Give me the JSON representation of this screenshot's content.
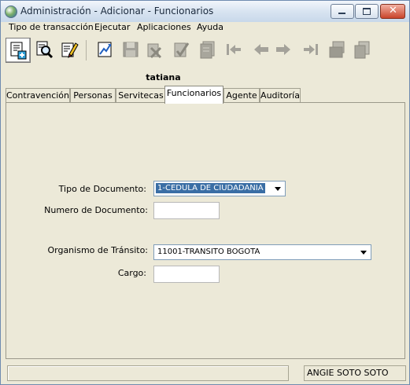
{
  "window": {
    "title": "Administración - Adicionar - Funcionarios"
  },
  "menu": [
    "Tipo de transacción",
    "Ejecutar",
    "Aplicaciones",
    "Ayuda"
  ],
  "toolbar": {
    "buttons": [
      "new-record-icon",
      "query-icon",
      "edit-icon",
      "export-icon",
      "save-icon",
      "delete-icon",
      "accept-icon",
      "document-icon",
      "first-record-icon",
      "previous-record-icon",
      "next-record-icon",
      "last-record-icon",
      "print-icon",
      "copy-icon"
    ]
  },
  "user": "tatiana",
  "tabs": [
    "Contravención",
    "Personas",
    "Servitecas",
    "Funcionarios",
    "Agente",
    "Auditoría"
  ],
  "active_tab": "Funcionarios",
  "form": {
    "tipo_documento": {
      "label": "Tipo de Documento:",
      "value": "1-CEDULA DE CIUDADANIA"
    },
    "numero_documento": {
      "label": "Numero de Documento:",
      "value": ""
    },
    "organismo": {
      "label": "Organismo de Tránsito:",
      "value": "11001-TRANSITO BOGOTA"
    },
    "cargo": {
      "label": "Cargo:",
      "value": ""
    }
  },
  "status": {
    "left": "",
    "right": "ANGIE  SOTO SOTO"
  },
  "colors": {
    "titlebar": "#d8e4f1",
    "window_bg": "#ece9d8",
    "selection": "#3a6ea5",
    "close_button": "#c9442a"
  }
}
